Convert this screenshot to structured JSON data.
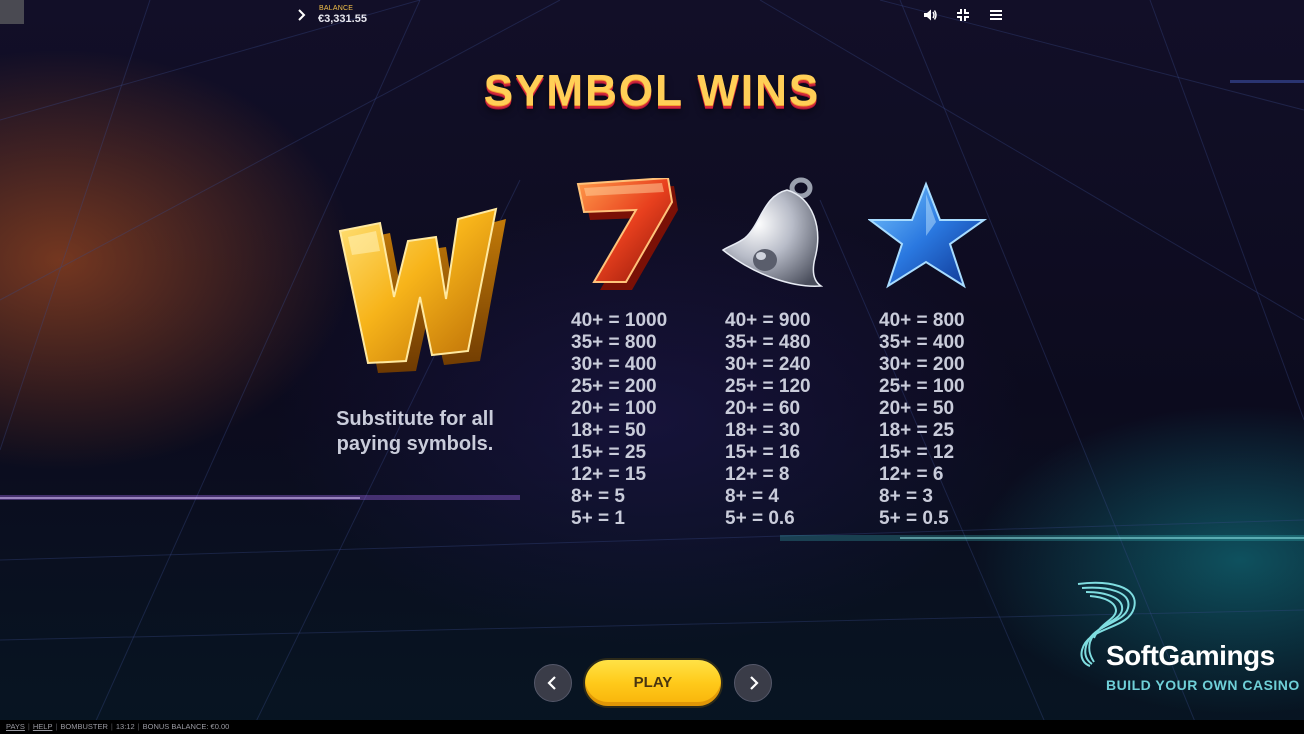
{
  "topbar": {
    "balance_label": "BALANCE",
    "balance_value": "€3,331.55",
    "icons": [
      "chevron-right-icon",
      "speaker-icon",
      "collapse-icon",
      "menu-icon"
    ]
  },
  "title": "SYMBOL WINS",
  "wild": {
    "symbol": "wild-w-icon",
    "description_line1": "Substitute for all",
    "description_line2": "paying symbols."
  },
  "paytable": [
    {
      "symbol": "seven-icon",
      "lines": [
        "40+ = 1000",
        "35+ = 800",
        "30+ = 400",
        "25+ = 200",
        "20+ = 100",
        "18+ = 50",
        "15+ = 25",
        "12+ = 15",
        "8+ = 5",
        "5+ = 1"
      ]
    },
    {
      "symbol": "bell-icon",
      "lines": [
        "40+ = 900",
        "35+ = 480",
        "30+ = 240",
        "25+ = 120",
        "20+ = 60",
        "18+ = 30",
        "15+ = 16",
        "12+ = 8",
        "8+ = 4",
        "5+ = 0.6"
      ]
    },
    {
      "symbol": "star-icon",
      "lines": [
        "40+ = 800",
        "35+ = 400",
        "30+ = 200",
        "25+ = 100",
        "20+ = 50",
        "18+ = 25",
        "15+ = 12",
        "12+ = 6",
        "8+ = 3",
        "5+ = 0.5"
      ]
    }
  ],
  "nav": {
    "play_label": "PLAY",
    "prev_icon": "chevron-left-icon",
    "next_icon": "chevron-right-icon"
  },
  "brand": {
    "name": "SoftGamings",
    "tagline": "BUILD YOUR OWN CASINO"
  },
  "footer": {
    "pays": "PAYS",
    "help": "HELP",
    "game": "BOMBUSTER",
    "time": "13:12",
    "bonus_balance": "BONUS BALANCE: €0.00"
  },
  "colors": {
    "title_fill": "#ffcf57",
    "title_shadow": "#d12a3a",
    "play_button": "#ffca1a",
    "paytable_text": "#c9ccda",
    "brand_tagline": "#6fd0d8",
    "balance_label": "#f2c04a"
  }
}
